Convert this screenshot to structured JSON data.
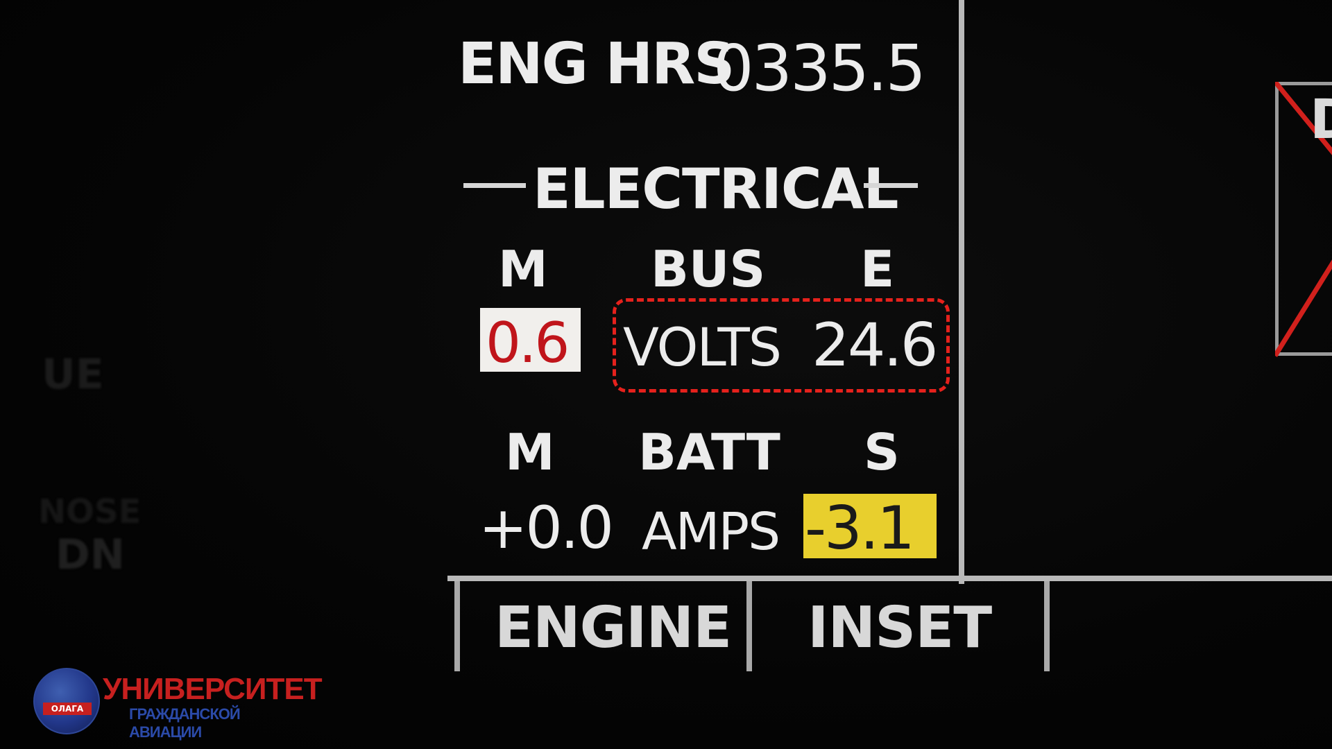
{
  "eis": {
    "eng_hrs_label": "ENG HRS",
    "eng_hrs_value": "0335.5",
    "electrical_title": "ELECTRICAL",
    "bus": {
      "left": "M",
      "label": "BUS",
      "right": "E"
    },
    "volts": {
      "m_value": "0.6",
      "label": "VOLTS",
      "e_value": "24.6"
    },
    "batt": {
      "left": "M",
      "label": "BATT",
      "right": "S"
    },
    "amps": {
      "m_value": "+0.0",
      "label": "AMPS",
      "s_value": "-3.1"
    }
  },
  "softkeys": [
    {
      "label": "ENGINE"
    },
    {
      "label": "INSET"
    },
    {
      "label": ""
    }
  ],
  "right_display": {
    "flag_text": "D"
  },
  "left_display_ghosts": {
    "ue": "UE",
    "nose": "NOSE",
    "dn": "DN"
  },
  "logo": {
    "title": "УНИВЕРСИТЕТ",
    "subtitle": "ГРАЖДАНСКОЙ АВИАЦИИ",
    "tag": "ОЛАГА"
  },
  "colors": {
    "alert_red": "#c0151b",
    "caution_yellow": "#e8cf2d",
    "highlight_annotation": "#e5211c",
    "text": "#ececec"
  }
}
